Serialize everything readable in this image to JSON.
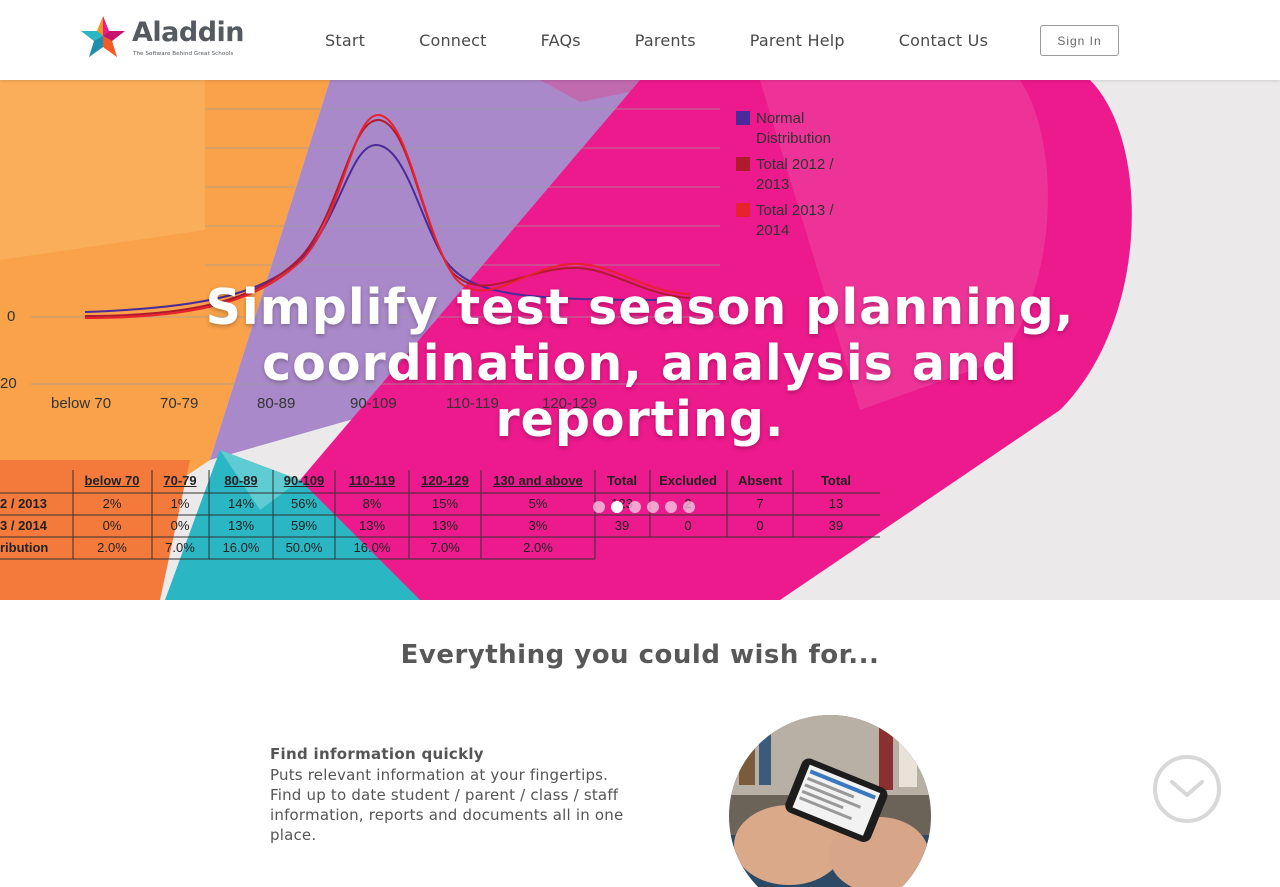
{
  "brand": {
    "name": "Aladdin",
    "tagline": "The Software Behind Great Schools"
  },
  "nav": {
    "items": [
      {
        "label": "Start"
      },
      {
        "label": "Connect"
      },
      {
        "label": "FAQs"
      },
      {
        "label": "Parents"
      },
      {
        "label": "Parent Help"
      },
      {
        "label": "Contact Us"
      }
    ],
    "sign_in": "Sign In"
  },
  "hero": {
    "headline": "Simplify test season planning, coordination, analysis and reporting.",
    "slides_count": 6,
    "active_slide": 1,
    "legend": [
      {
        "label_line1": "Normal",
        "label_line2": "Distribution",
        "color": "#4b2a9a"
      },
      {
        "label_line1": "Total 2012 /",
        "label_line2": "2013",
        "color": "#b01a2e"
      },
      {
        "label_line1": "Total 2013 /",
        "label_line2": "2014",
        "color": "#e8222d"
      }
    ],
    "axis_ticks": [
      "0",
      "20"
    ],
    "categories": [
      "below 70",
      "70-79",
      "80-89",
      "90-109",
      "110-119",
      "120-129",
      "130 and above"
    ],
    "table": {
      "headers": [
        "below 70",
        "70-79",
        "80-89",
        "90-109",
        "110-119",
        "120-129",
        "130 and above",
        "Total",
        "Excluded",
        "Absent",
        "Total"
      ],
      "rows": [
        {
          "label": "2 / 2013",
          "cells": [
            "2%",
            "1%",
            "14%",
            "56%",
            "8%",
            "15%",
            "5%",
            "123",
            "2",
            "7",
            "13"
          ]
        },
        {
          "label": "3 / 2014",
          "cells": [
            "0%",
            "0%",
            "13%",
            "59%",
            "13%",
            "13%",
            "3%",
            "39",
            "0",
            "0",
            "39"
          ]
        },
        {
          "label": "ribution",
          "cells": [
            "2.0%",
            "7.0%",
            "16.0%",
            "50.0%",
            "16.0%",
            "7.0%",
            "2.0%",
            "",
            "",
            "",
            ""
          ]
        }
      ]
    }
  },
  "section": {
    "title": "Everything you could wish for..."
  },
  "feature": {
    "title": "Find information quickly",
    "text": "Puts relevant information at your fingertips. Find up to date student / parent / class / staff information, reports and documents all in one place."
  },
  "colors": {
    "accent_pink": "#ec1a8c",
    "accent_orange": "#f7941d",
    "accent_teal": "#2ab7c3",
    "accent_purple": "#8e7cc3"
  },
  "icons": {
    "scroll": "chevron-down-circle-icon"
  }
}
